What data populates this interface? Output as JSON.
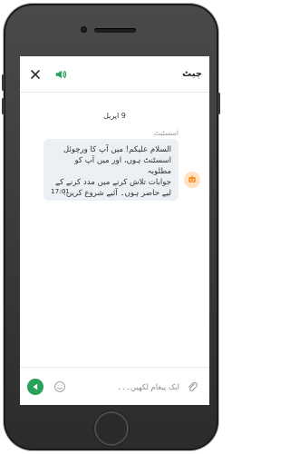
{
  "header": {
    "title": "چیٹ",
    "close_icon": "close-icon",
    "sound_icon": "sound-icon"
  },
  "chat": {
    "date": "9 اپریل",
    "sender": "اسسٹنٹ",
    "message": "السلام علیکم! میں آپ کا ورچوئل\nاسسٹنٹ ہوں، اور میں آپ کو مطلوبہ\nجوابات تلاش کرنے میں مدد کرنے کے\nلیے حاضر ہوں۔ آئیے شروع کریں!",
    "time": "17:01",
    "avatar_icon": "robot-icon"
  },
  "input": {
    "placeholder": "ایک پیغام لکھیں۔۔۔",
    "send_icon": "send-icon",
    "emoji_icon": "emoji-icon",
    "attach_icon": "paperclip-icon"
  },
  "colors": {
    "accent": "#2aa15a",
    "bubble": "#eceff3",
    "avatar": "#ffe2bf"
  }
}
